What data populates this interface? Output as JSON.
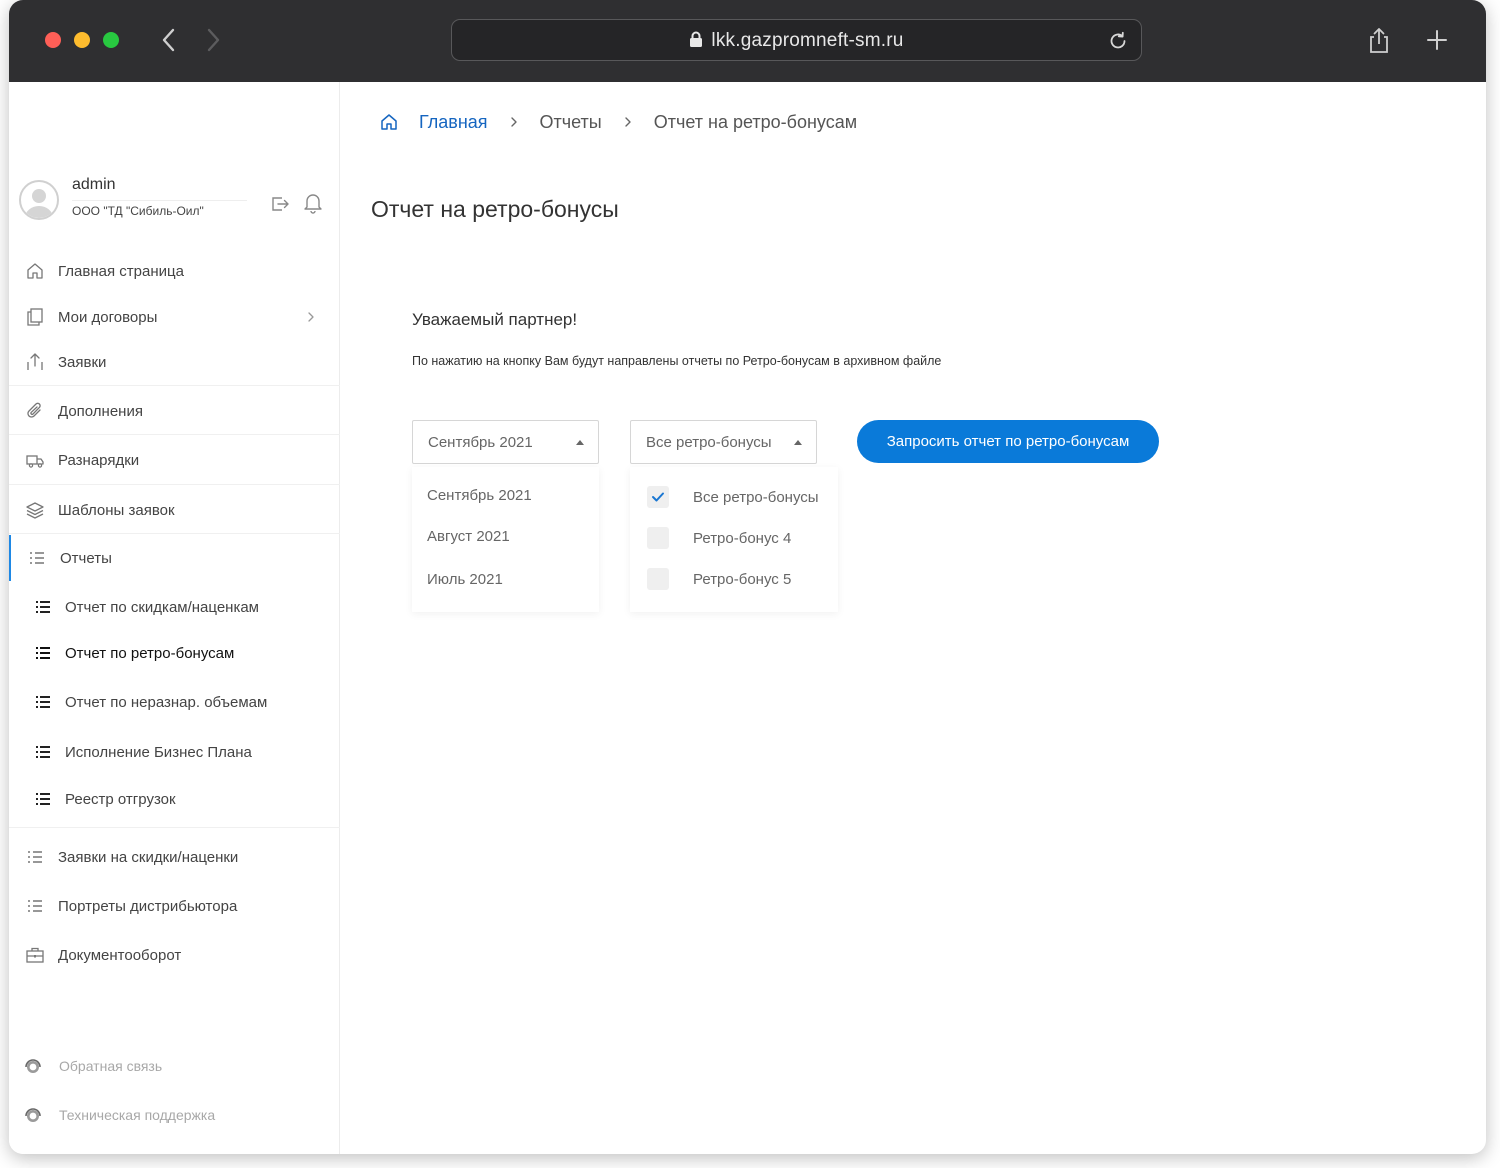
{
  "browser": {
    "url": "lkk.gazpromneft-sm.ru"
  },
  "user": {
    "name": "admin",
    "organization": "ООО \"ТД \"Сибиль-Оил\""
  },
  "sidebar": {
    "items": [
      {
        "label": "Главная страница",
        "icon": "home-icon"
      },
      {
        "label": "Мои договоры",
        "icon": "documents-icon"
      },
      {
        "label": "Заявки",
        "icon": "upload-icon"
      },
      {
        "label": "Дополнения",
        "icon": "paperclip-icon"
      },
      {
        "label": "Разнарядки",
        "icon": "truck-icon"
      },
      {
        "label": "Шаблоны заявок",
        "icon": "layers-icon"
      },
      {
        "label": "Отчеты",
        "icon": "list-icon"
      }
    ],
    "reports_sub": [
      {
        "label": "Отчет по скидкам/наценкам"
      },
      {
        "label": "Отчет по ретро-бонусам"
      },
      {
        "label": "Отчет по неразнар. объемам"
      },
      {
        "label": "Исполнение Бизнес Плана"
      },
      {
        "label": "Реестр отгрузок"
      }
    ],
    "items_after": [
      {
        "label": "Заявки на скидки/наценки",
        "icon": "list-icon"
      },
      {
        "label": "Портреты дистрибьютора",
        "icon": "list-icon"
      },
      {
        "label": "Документооборот",
        "icon": "briefcase-icon"
      }
    ],
    "footer": [
      {
        "label": "Обратная связь",
        "icon": "headset-icon"
      },
      {
        "label": "Техническая поддержка",
        "icon": "headset-icon"
      }
    ]
  },
  "breadcrumb": {
    "home": "Главная",
    "section": "Отчеты",
    "current": "Отчет на ретро-бонусам"
  },
  "main": {
    "title": "Отчет на ретро-бонусы",
    "greeting": "Уважаемый партнер!",
    "info": "По нажатию на кнопку Вам будут направлены отчеты по Ретро-бонусам в архивном файле",
    "month_select": {
      "value": "Сентябрь 2021",
      "options": [
        "Сентябрь 2021",
        "Август 2021",
        "Июль 2021"
      ]
    },
    "bonus_select": {
      "value": "Все ретро-бонусы",
      "options": [
        {
          "label": "Все ретро-бонусы",
          "checked": true
        },
        {
          "label": "Ретро-бонус 4",
          "checked": false
        },
        {
          "label": "Ретро-бонус 5",
          "checked": false
        }
      ]
    },
    "request_button": "Запросить отчет по ретро-бонусам"
  },
  "colors": {
    "accent": "#0a7ad9",
    "link": "#1565c0",
    "titlebar": "#2f2f31"
  }
}
